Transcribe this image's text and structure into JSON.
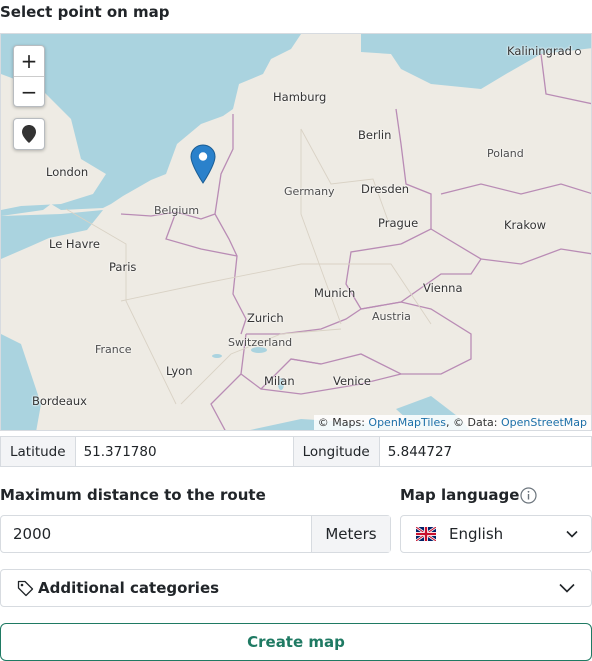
{
  "section": {
    "title": "Select point on map"
  },
  "map": {
    "zoom_in": "+",
    "zoom_out": "−",
    "labels": {
      "kaliningrad": "Kaliningrad",
      "hamburg": "Hamburg",
      "berlin": "Berlin",
      "london": "London",
      "poland": "Poland",
      "germany": "Germany",
      "dresden": "Dresden",
      "belgium": "Belgium",
      "prague": "Prague",
      "krakow": "Krakow",
      "le_havre": "Le Havre",
      "paris": "Paris",
      "munich": "Munich",
      "vienna": "Vienna",
      "zurich": "Zurich",
      "austria": "Austria",
      "switzerland": "Switzerland",
      "france": "France",
      "lyon": "Lyon",
      "milan": "Milan",
      "venice": "Venice",
      "bordeaux": "Bordeaux"
    },
    "attribution": {
      "prefix": "© Maps: ",
      "tiles_link": "OpenMapTiles",
      "middle": ", © Data: ",
      "data_link": "OpenStreetMap"
    },
    "colors": {
      "water": "#aad3df",
      "land": "#eeebe4",
      "border": "#b98cb5",
      "marker": "#2a81cb"
    }
  },
  "coords": {
    "lat_label": "Latitude",
    "lat_value": "51.371780",
    "lng_label": "Longitude",
    "lng_value": "5.844727"
  },
  "distance": {
    "title": "Maximum distance to the route",
    "value": "2000",
    "unit": "Meters"
  },
  "language": {
    "title": "Map language",
    "selected": "English",
    "icon": "info-icon"
  },
  "categories": {
    "label": "Additional categories",
    "icon": "tag-icon"
  },
  "actions": {
    "create": "Create map",
    "accent": "#1f7a63"
  }
}
